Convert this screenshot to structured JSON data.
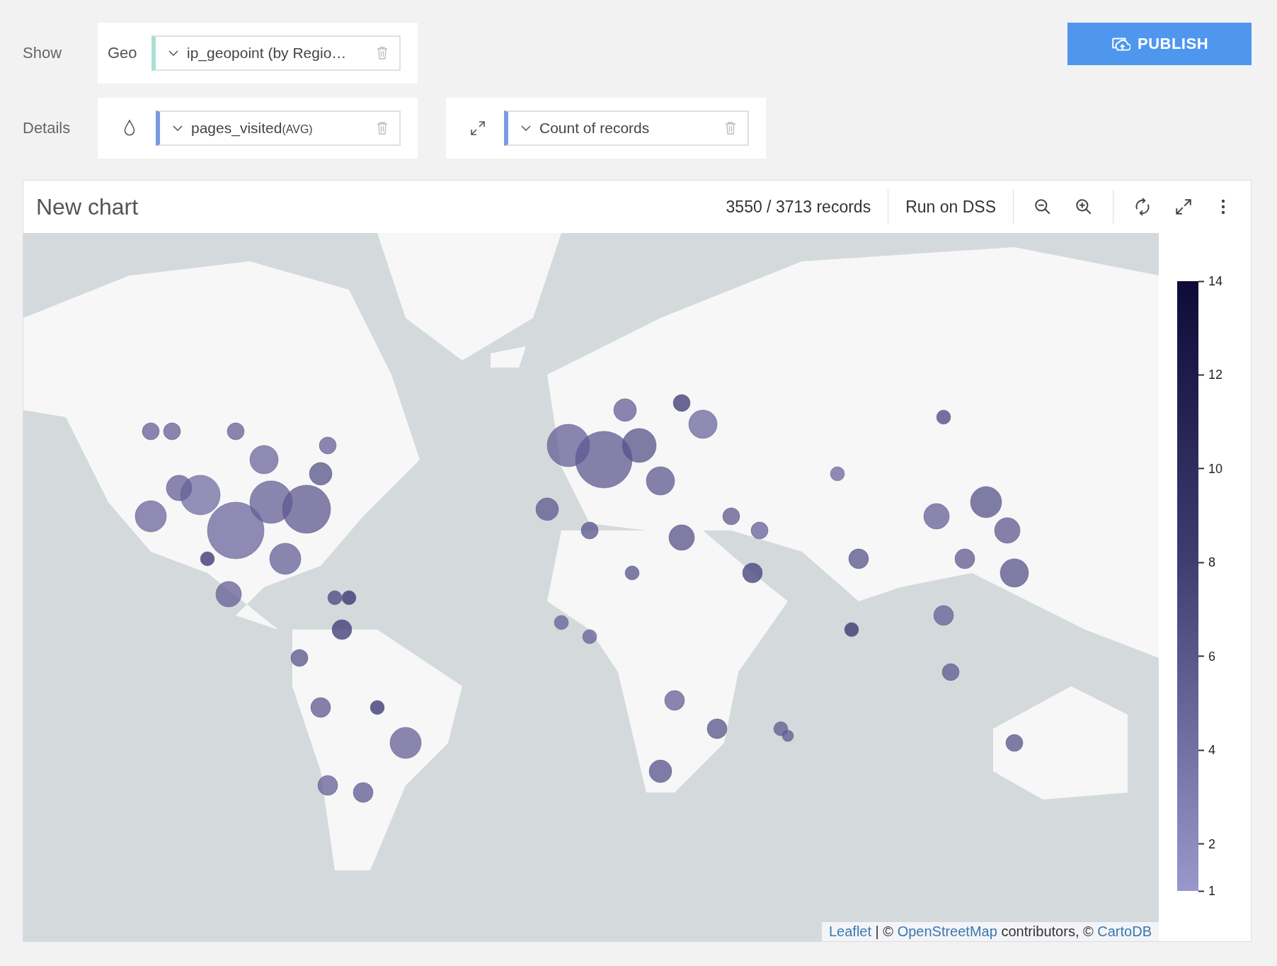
{
  "show_row": {
    "label": "Show",
    "shelves": [
      {
        "label": "Geo",
        "field": "ip_geopoint (by Regio…"
      }
    ]
  },
  "details_row": {
    "label": "Details",
    "shelves": [
      {
        "kind": "color",
        "field": "pages_visited",
        "aggregation": "(AVG)"
      },
      {
        "kind": "size",
        "field": "Count of records"
      }
    ]
  },
  "publish_button": "PUBLISH",
  "chart": {
    "title": "New chart",
    "records": "3550 / 3713 records",
    "run_button": "Run on DSS",
    "legend_ticks": [
      "14",
      "12",
      "10",
      "8",
      "6",
      "4",
      "2",
      "1"
    ],
    "attribution": [
      {
        "kind": "link",
        "text": "Leaflet"
      },
      {
        "kind": "text",
        "text": " | © "
      },
      {
        "kind": "link",
        "text": "OpenStreetMap"
      },
      {
        "kind": "text",
        "text": " contributors, © "
      },
      {
        "kind": "link",
        "text": "CartoDB"
      }
    ]
  }
}
